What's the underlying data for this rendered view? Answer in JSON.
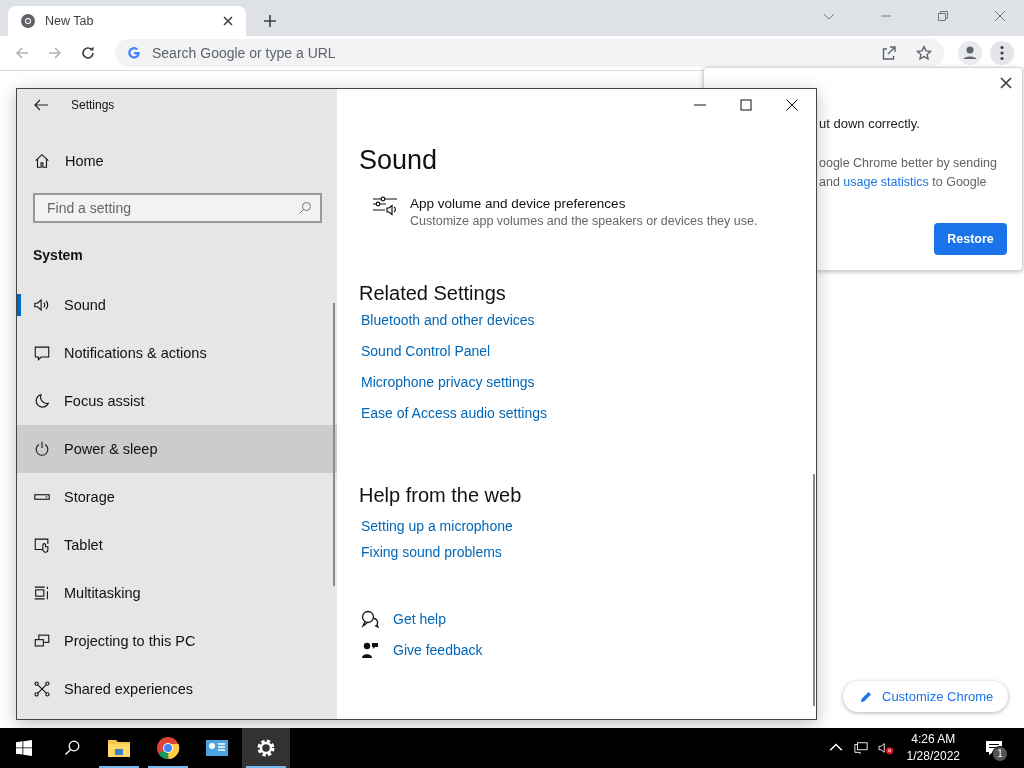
{
  "browser": {
    "tab": {
      "title": "New Tab"
    },
    "address_bar": {
      "placeholder": "Search Google or type a URL"
    },
    "restore_popup": {
      "line_1": "ut down correctly.",
      "line_2": "oogle Chrome better by sending",
      "line_3_prefix": "and",
      "line_3_link": "usage statistics",
      "line_3_suffix": "to Google",
      "button": "Restore"
    },
    "customize_button": "Customize Chrome"
  },
  "settings_window": {
    "title": "Settings",
    "home": "Home",
    "search": {
      "placeholder": "Find a setting"
    },
    "section": "System",
    "nav_items": [
      {
        "label": "Sound",
        "kind": "speaker",
        "selected": true,
        "hovered": false
      },
      {
        "label": "Notifications & actions",
        "kind": "notification",
        "selected": false,
        "hovered": false
      },
      {
        "label": "Focus assist",
        "kind": "moon",
        "selected": false,
        "hovered": false
      },
      {
        "label": "Power & sleep",
        "kind": "power",
        "selected": false,
        "hovered": true
      },
      {
        "label": "Storage",
        "kind": "storage",
        "selected": false,
        "hovered": false
      },
      {
        "label": "Tablet",
        "kind": "tablet",
        "selected": false,
        "hovered": false
      },
      {
        "label": "Multitasking",
        "kind": "multitasking",
        "selected": false,
        "hovered": false
      },
      {
        "label": "Projecting to this PC",
        "kind": "projecting",
        "selected": false,
        "hovered": false
      },
      {
        "label": "Shared experiences",
        "kind": "shared",
        "selected": false,
        "hovered": false
      }
    ],
    "page_title": "Sound",
    "app_volume": {
      "title": "App volume and device preferences",
      "description": "Customize app volumes and the speakers or devices they use."
    },
    "related": {
      "heading": "Related Settings",
      "links": [
        "Bluetooth and other devices",
        "Sound Control Panel",
        "Microphone privacy settings",
        "Ease of Access audio settings"
      ]
    },
    "help": {
      "heading": "Help from the web",
      "links": [
        "Setting up a microphone",
        "Fixing sound problems"
      ]
    },
    "support_links": [
      {
        "label": "Get help",
        "kind": "help"
      },
      {
        "label": "Give feedback",
        "kind": "feedback"
      }
    ]
  },
  "taskbar": {
    "apps": [
      {
        "kind": "explorer",
        "running": true,
        "active": false
      },
      {
        "kind": "chrome",
        "running": true,
        "active": false
      },
      {
        "kind": "control-panel",
        "running": false,
        "active": false
      },
      {
        "kind": "settings",
        "running": true,
        "active": true
      }
    ],
    "time": "4:26 AM",
    "date": "1/28/2022",
    "notification_count": "1"
  }
}
